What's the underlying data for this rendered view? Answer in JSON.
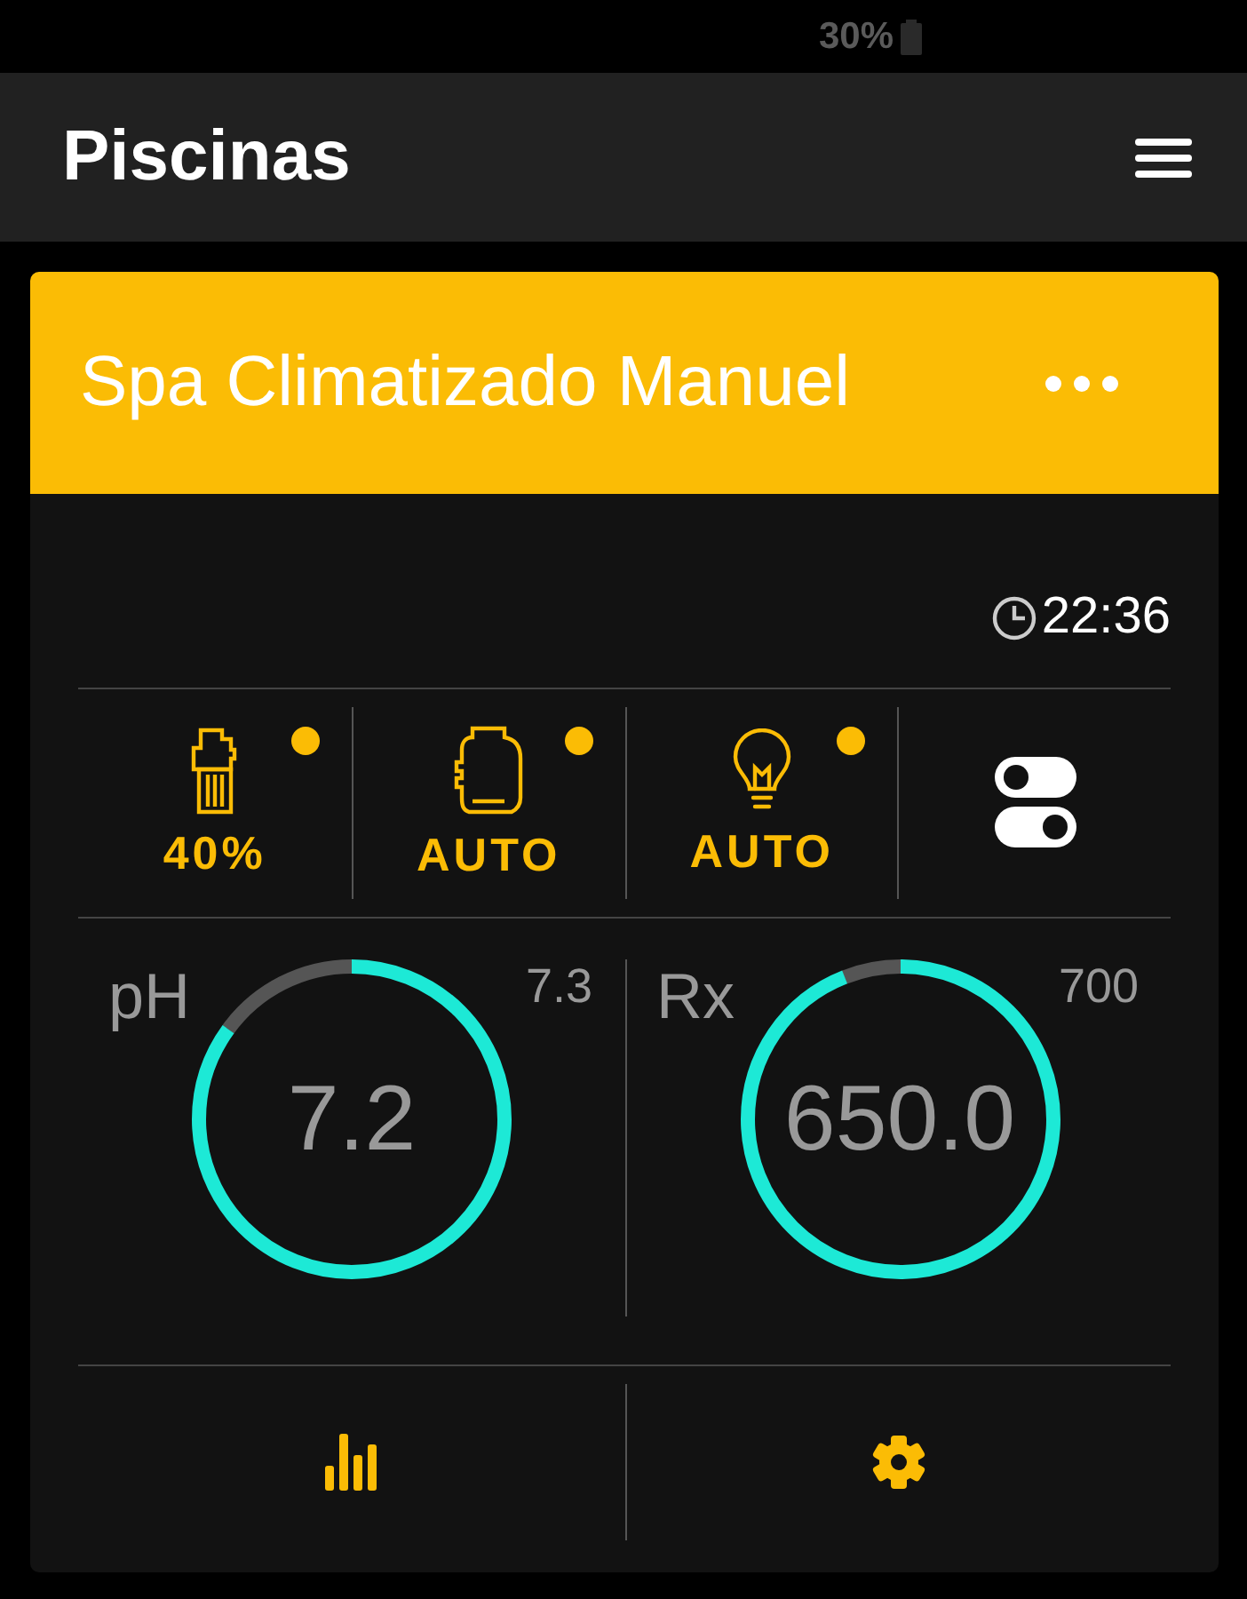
{
  "status_bar": {
    "battery": "30%"
  },
  "header": {
    "title": "Piscinas"
  },
  "card": {
    "title": "Spa Climatizado Manuel",
    "time": "22:36",
    "devices": [
      {
        "kind": "pump",
        "label": "40%",
        "on": true
      },
      {
        "kind": "heater",
        "label": "AUTO",
        "on": true
      },
      {
        "kind": "light",
        "label": "AUTO",
        "on": true
      },
      {
        "kind": "switches"
      }
    ],
    "gauges": [
      {
        "name": "pH",
        "value": "7.2",
        "target": "7.3",
        "level": 0.85
      },
      {
        "name": "Rx",
        "value": "650.0",
        "target": "700",
        "level": 0.94
      }
    ]
  }
}
